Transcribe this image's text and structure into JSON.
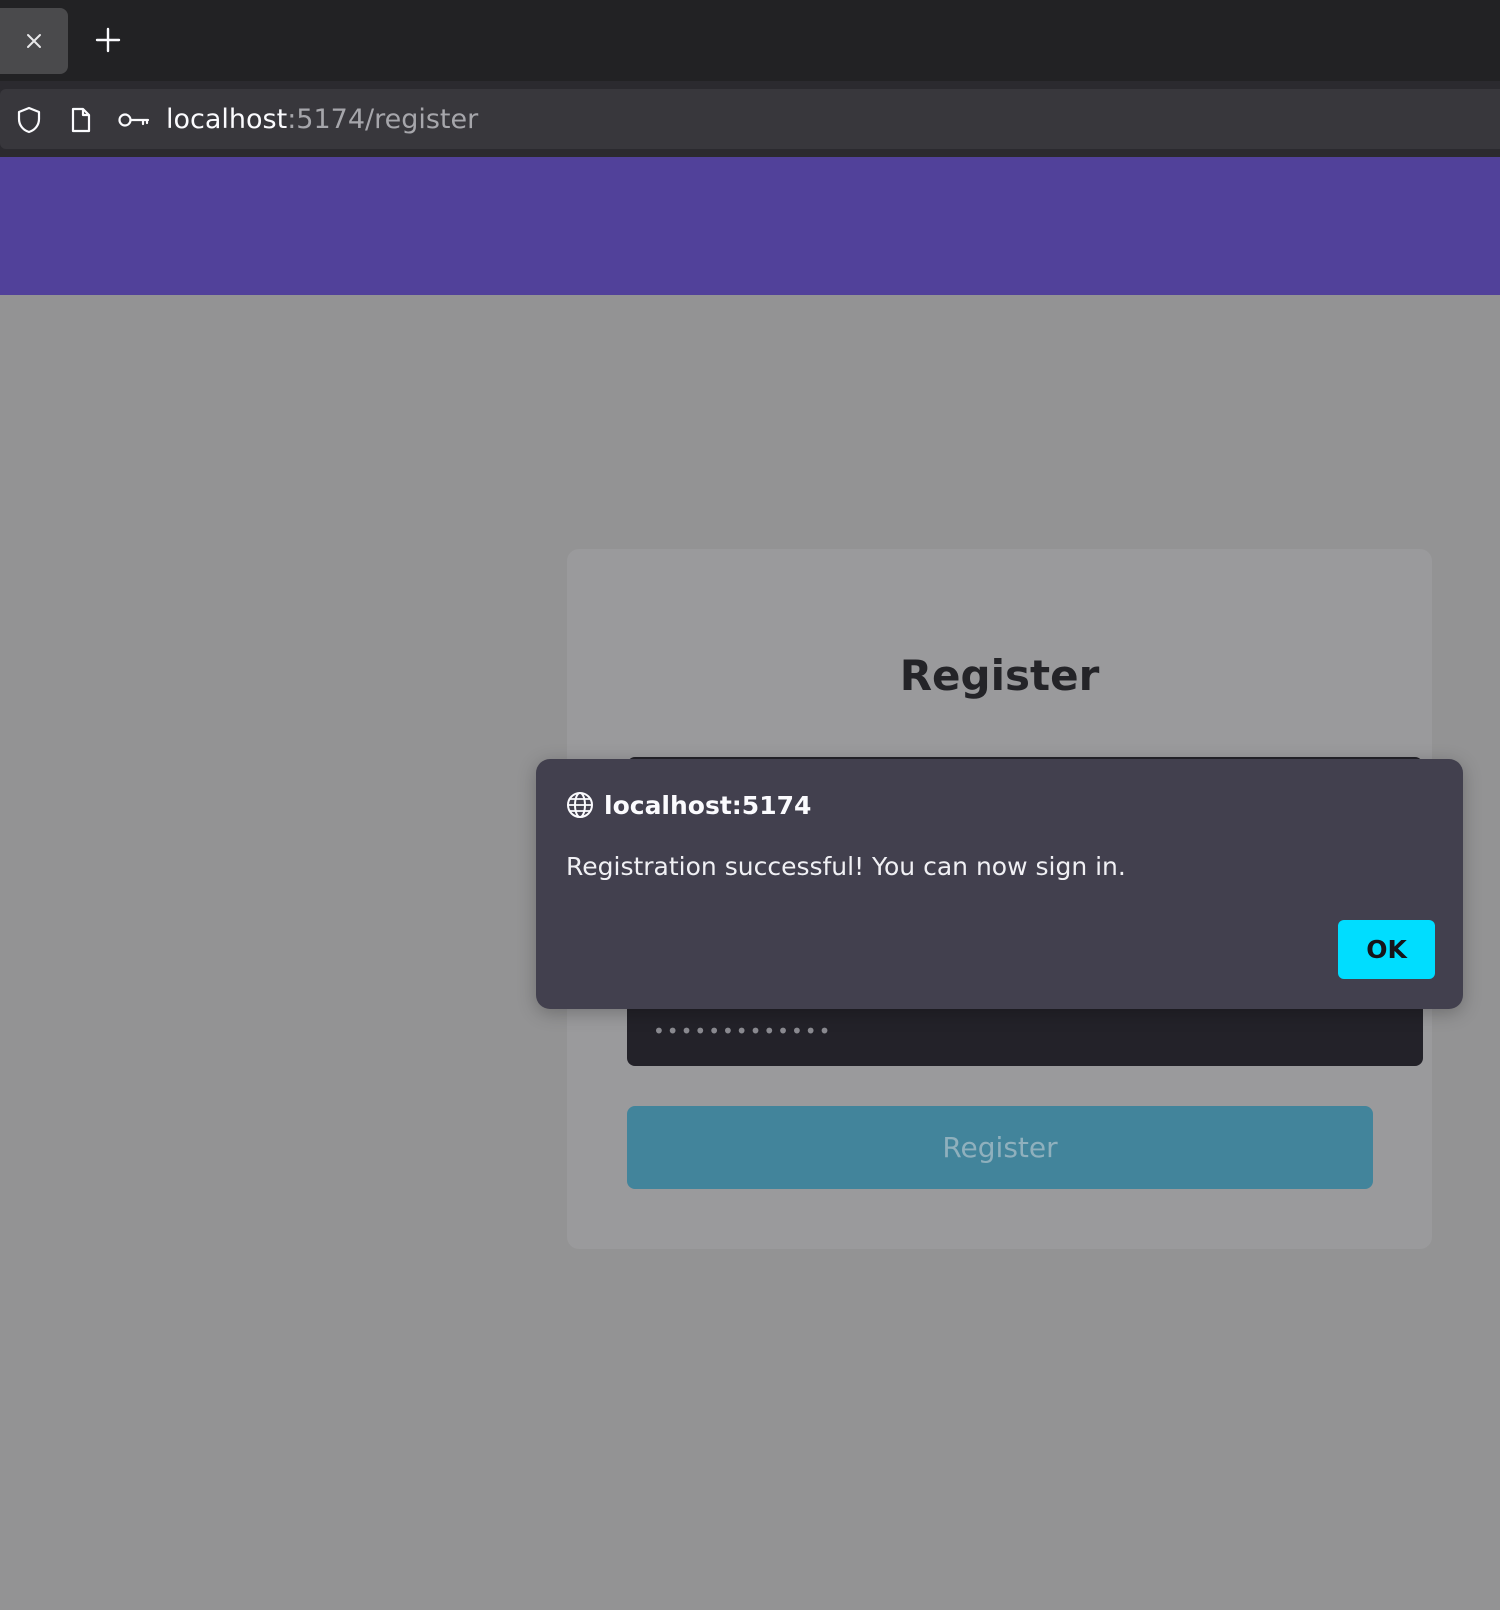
{
  "browser": {
    "tab_close_icon": "close-icon",
    "new_tab_icon": "plus-icon",
    "url": {
      "host": "localhost",
      "rest": ":5174/register"
    },
    "icons": [
      "shield-icon",
      "page-icon",
      "key-icon"
    ]
  },
  "page": {
    "header_color": "#51419a",
    "card": {
      "title": "Register",
      "password_value": "•••••••••••••",
      "submit_label": "Register"
    }
  },
  "dialog": {
    "origin": "localhost:5174",
    "message": "Registration successful! You can now sign in.",
    "ok_label": "OK",
    "accent": "#00ddff"
  }
}
